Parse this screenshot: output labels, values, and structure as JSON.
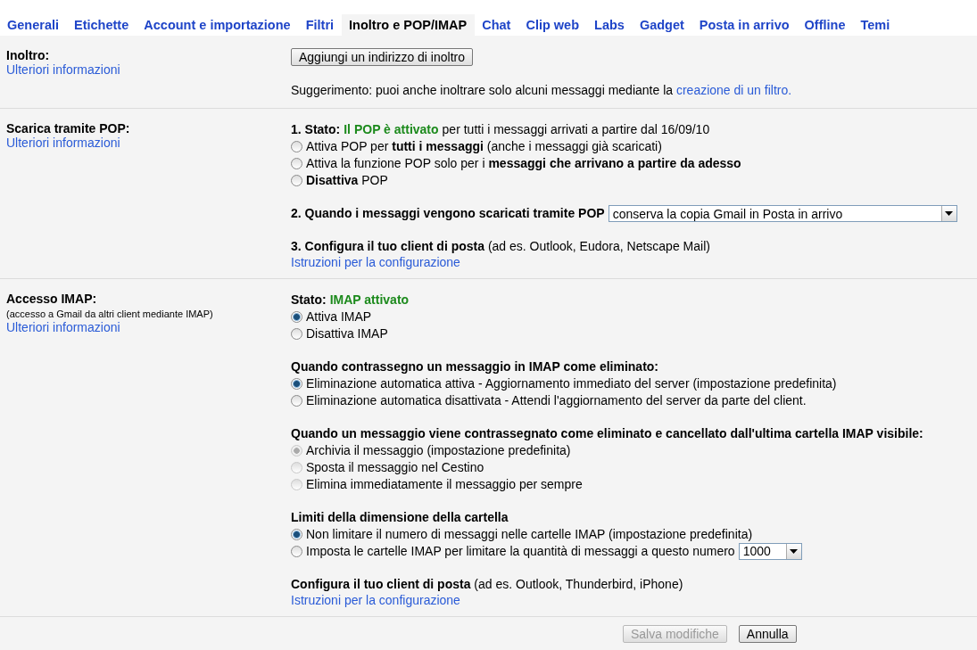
{
  "tabs": [
    {
      "label": "Generali",
      "selected": false
    },
    {
      "label": "Etichette",
      "selected": false
    },
    {
      "label": "Account e importazione",
      "selected": false
    },
    {
      "label": "Filtri",
      "selected": false
    },
    {
      "label": "Inoltro e POP/IMAP",
      "selected": true
    },
    {
      "label": "Chat",
      "selected": false
    },
    {
      "label": "Clip web",
      "selected": false
    },
    {
      "label": "Labs",
      "selected": false
    },
    {
      "label": "Gadget",
      "selected": false
    },
    {
      "label": "Posta in arrivo",
      "selected": false
    },
    {
      "label": "Offline",
      "selected": false
    },
    {
      "label": "Temi",
      "selected": false
    }
  ],
  "sections": [
    {
      "label": "Inoltro:",
      "link": "Ulteriori informazioni",
      "blocks": [
        {
          "kind": "button",
          "label": "Aggiungi un indirizzo di inoltro"
        },
        {
          "kind": "hint",
          "text": "Suggerimento: puoi anche inoltrare solo alcuni messaggi mediante la",
          "link": "creazione di un filtro."
        }
      ]
    },
    {
      "label": "Scarica tramite POP:",
      "link": "Ulteriori informazioni",
      "blocks": [
        {
          "kind": "radios",
          "status": {
            "label": "1. Stato:",
            "value": "Il POP è attivato",
            "rest": "per tutti i messaggi arrivati a partire dal 16/09/10"
          },
          "options": [
            {
              "label": "Attiva POP per **tutti i messaggi** (anche i messaggi già scaricati)",
              "selected": false,
              "disabled": false
            },
            {
              "label": "Attiva la funzione POP solo per i **messaggi che arrivano a partire da adesso**",
              "selected": false,
              "disabled": false
            },
            {
              "label": "**Disattiva** POP",
              "selected": false,
              "disabled": false
            }
          ]
        },
        {
          "kind": "select_row",
          "label": "2. Quando i messaggi vengono scaricati tramite POP",
          "value": "conserva la copia Gmail in Posta in arrivo"
        },
        {
          "kind": "config",
          "heading": "3. Configura il tuo client di posta",
          "rest": "(ad es. Outlook, Eudora, Netscape Mail)",
          "link": "Istruzioni per la configurazione"
        }
      ]
    },
    {
      "label": "Accesso IMAP:",
      "note": "(accesso a Gmail da altri client mediante IMAP)",
      "link": "Ulteriori informazioni",
      "blocks": [
        {
          "kind": "radios",
          "status": {
            "label": "Stato:",
            "value": "IMAP attivato"
          },
          "options": [
            {
              "label": "Attiva IMAP",
              "selected": true,
              "disabled": false
            },
            {
              "label": "Disattiva IMAP",
              "selected": false,
              "disabled": false
            }
          ]
        },
        {
          "kind": "radios",
          "heading": "Quando contrassegno un messaggio in IMAP come eliminato:",
          "options": [
            {
              "label": "Eliminazione automatica attiva - Aggiornamento immediato del server (impostazione predefinita)",
              "selected": true,
              "disabled": false
            },
            {
              "label": "Eliminazione automatica disattivata - Attendi l'aggiornamento del server da parte del client.",
              "selected": false,
              "disabled": false
            }
          ]
        },
        {
          "kind": "radios",
          "heading": "Quando un messaggio viene contrassegnato come eliminato e cancellato dall'ultima cartella IMAP visibile:",
          "options": [
            {
              "label": "Archivia il messaggio (impostazione predefinita)",
              "selected": true,
              "disabled": true
            },
            {
              "label": "Sposta il messaggio nel Cestino",
              "selected": false,
              "disabled": true
            },
            {
              "label": "Elimina immediatamente il messaggio per sempre",
              "selected": false,
              "disabled": true
            }
          ]
        },
        {
          "kind": "radios",
          "heading": "Limiti della dimensione della cartella",
          "options": [
            {
              "label": "Non limitare il numero di messaggi nelle cartelle IMAP (impostazione predefinita)",
              "selected": true,
              "disabled": false
            },
            {
              "label": "Imposta le cartelle IMAP per limitare la quantità di messaggi a questo numero",
              "selected": false,
              "disabled": false,
              "select": "1000"
            }
          ]
        },
        {
          "kind": "config",
          "heading": "Configura il tuo client di posta",
          "rest": "(ad es. Outlook, Thunderbird, iPhone)",
          "link": "Istruzioni per la configurazione"
        }
      ]
    }
  ],
  "footer": [
    {
      "label": "Salva modifiche",
      "disabled": true
    },
    {
      "label": "Annulla",
      "disabled": false
    }
  ]
}
